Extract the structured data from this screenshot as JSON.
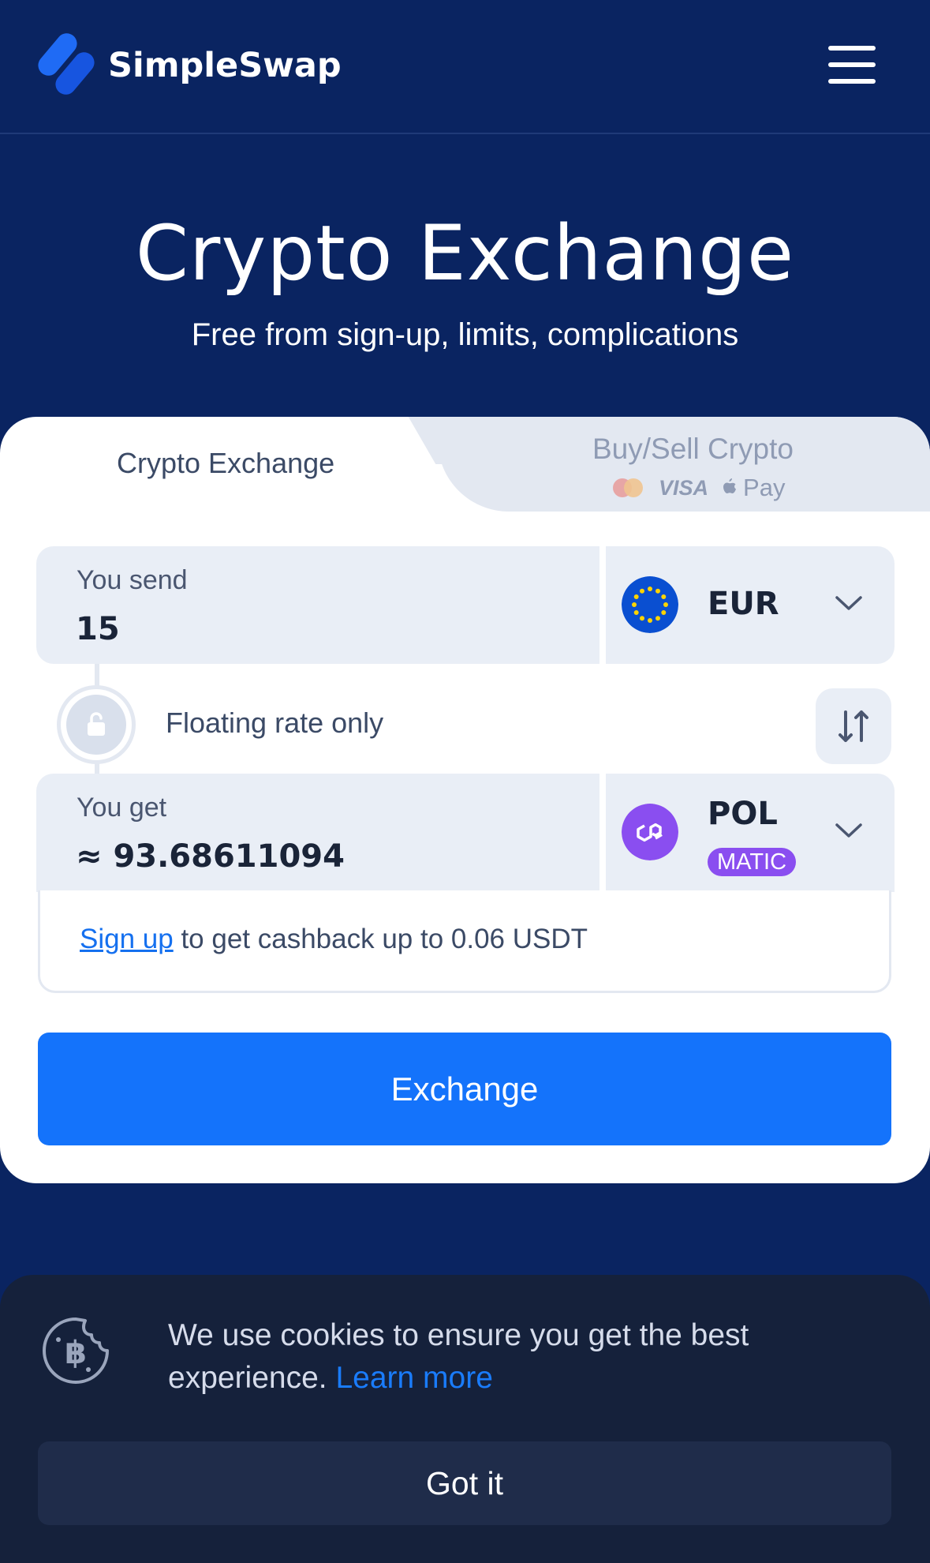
{
  "header": {
    "brand": "SimpleSwap"
  },
  "hero": {
    "title": "Crypto Exchange",
    "subtitle": "Free from sign-up, limits, complications"
  },
  "tabs": {
    "crypto_exchange": "Crypto Exchange",
    "buy_sell": "Buy/Sell Crypto",
    "visa": "VISA",
    "apple_pay": "Pay"
  },
  "send": {
    "label": "You send",
    "value": "15",
    "currency": "EUR",
    "currency_icon": "eu-flag-icon"
  },
  "rate": {
    "label": "Floating rate only"
  },
  "get": {
    "label": "You get",
    "value": "≈ 93.68611094",
    "currency": "POL",
    "network_badge": "MATIC",
    "currency_icon": "polygon-icon"
  },
  "cashback": {
    "link": "Sign up",
    "text": " to get cashback up to 0.06 USDT"
  },
  "exchange_button": "Exchange",
  "cookie": {
    "text": "We use cookies to ensure you get the best experience. ",
    "link": "Learn more",
    "button": "Got it"
  },
  "colors": {
    "background": "#0a2461",
    "primary": "#1473fb",
    "polygon": "#8a4ef0",
    "eu": "#0a4fd1"
  }
}
